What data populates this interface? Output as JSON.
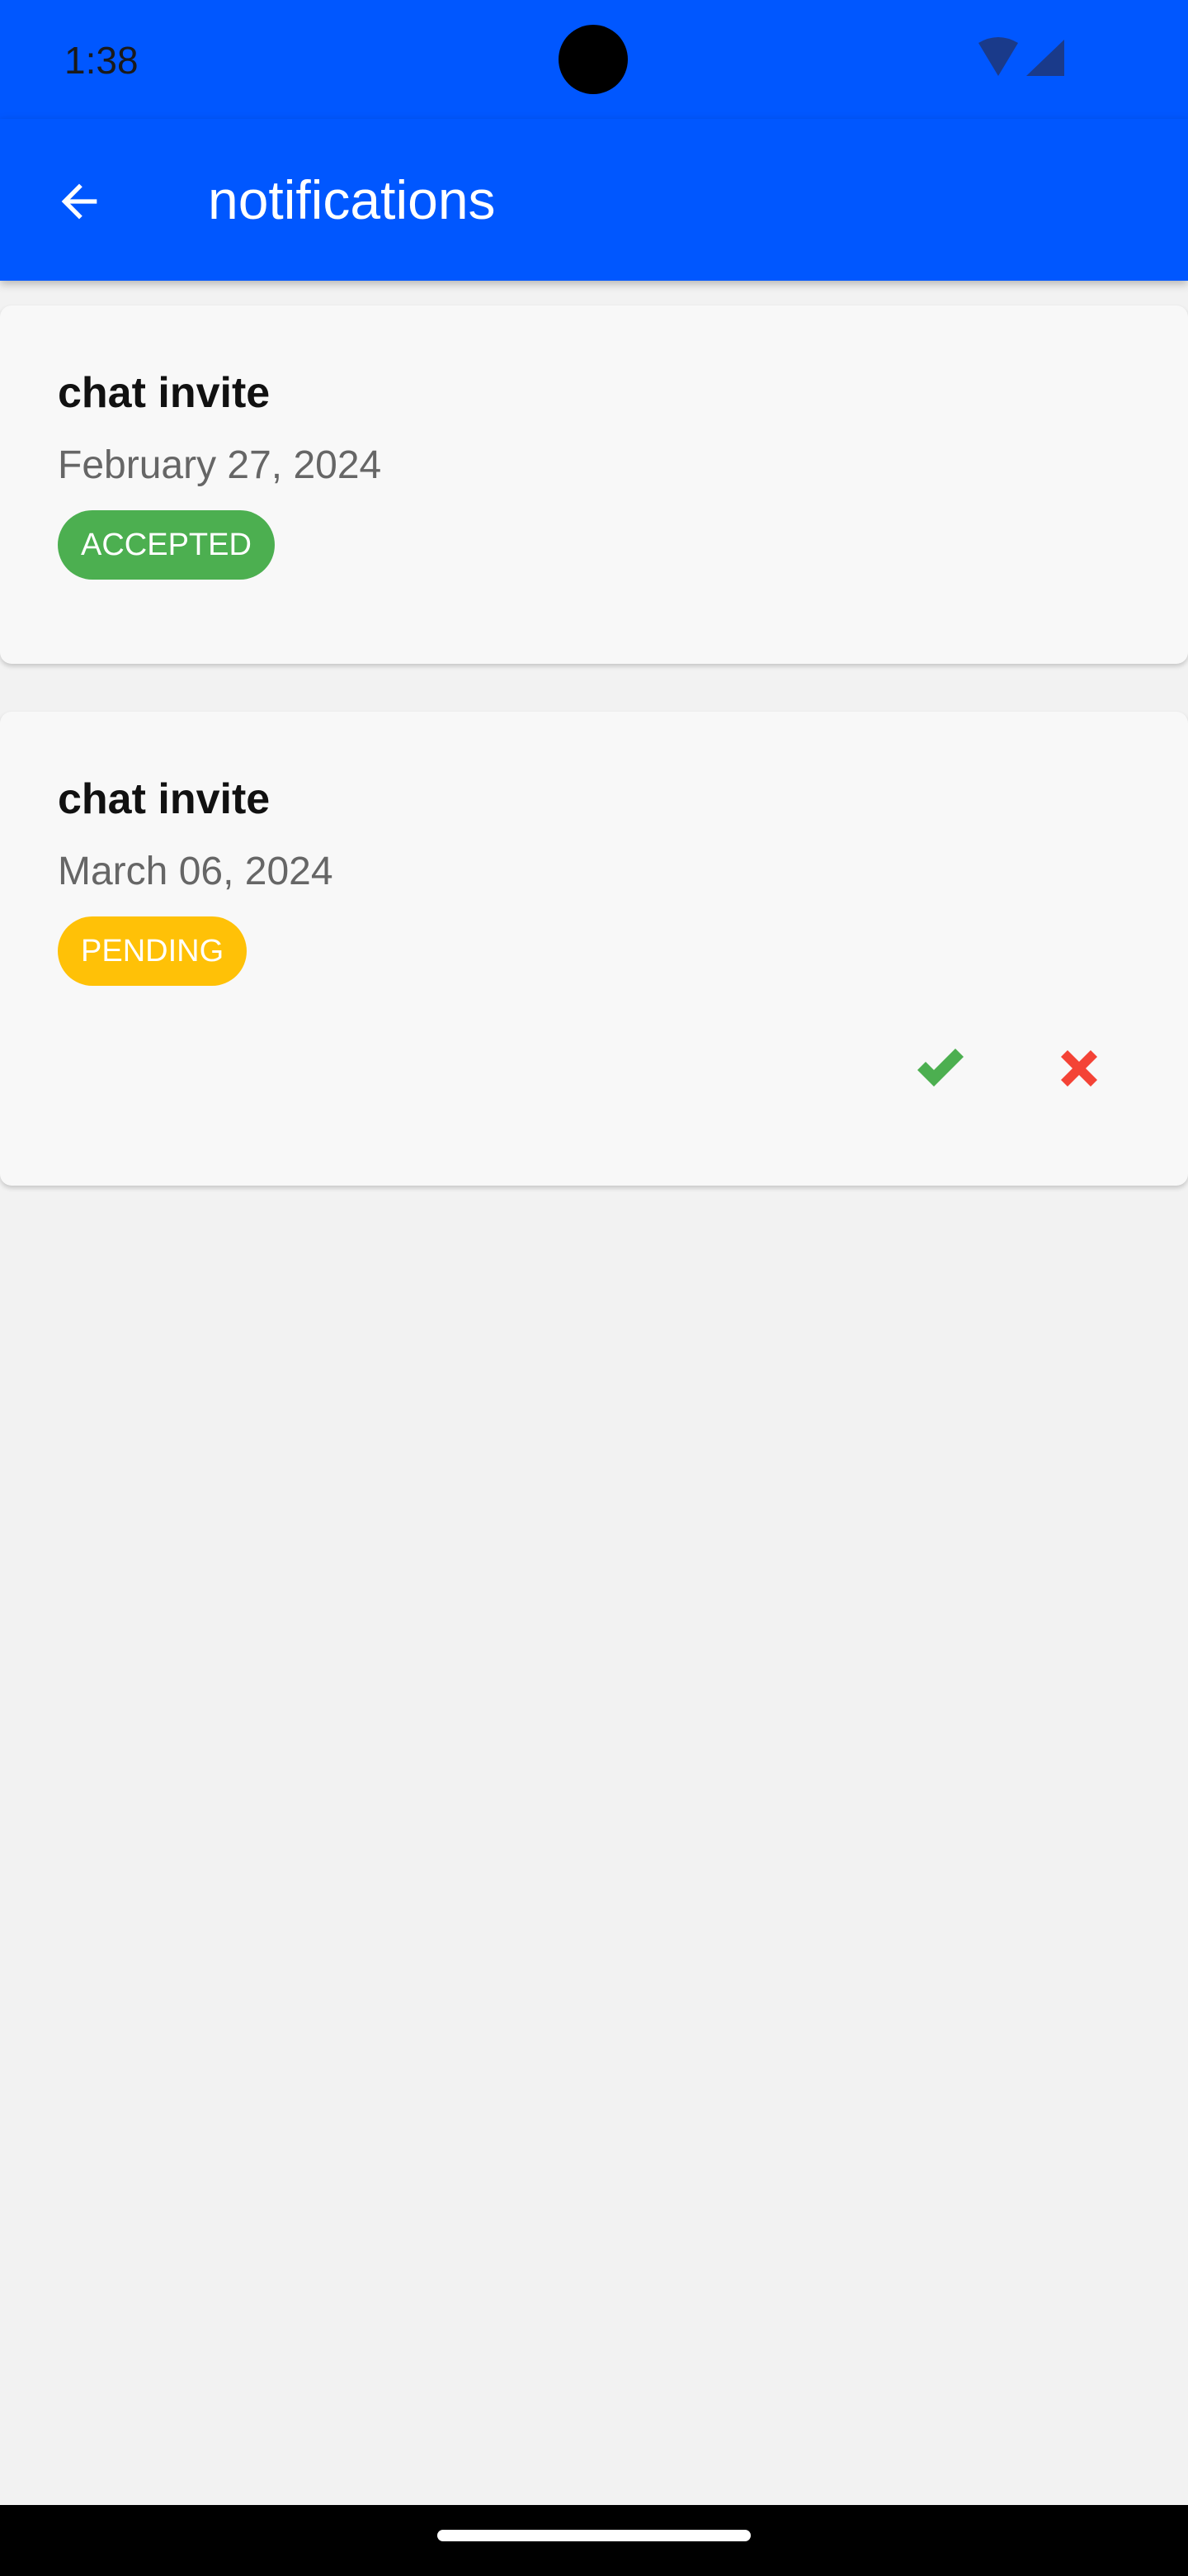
{
  "status_bar": {
    "time": "1:38",
    "icons": [
      "wifi-icon",
      "cell-signal-icon"
    ]
  },
  "app_bar": {
    "title": "notifications",
    "back_icon": "arrow-left-icon"
  },
  "notifications": [
    {
      "title": "chat invite",
      "date": "February 27, 2024",
      "status": "ACCEPTED",
      "status_color": "#4caf50"
    },
    {
      "title": "chat invite",
      "date": "March 06, 2024",
      "status": "PENDING",
      "status_color": "#ffc107",
      "actions": [
        "check-icon",
        "close-icon"
      ]
    }
  ],
  "colors": {
    "primary": "#0057ff",
    "background": "#f2f2f2",
    "card": "#f8f8f8",
    "accept": "#4caf50",
    "reject": "#f44336"
  }
}
